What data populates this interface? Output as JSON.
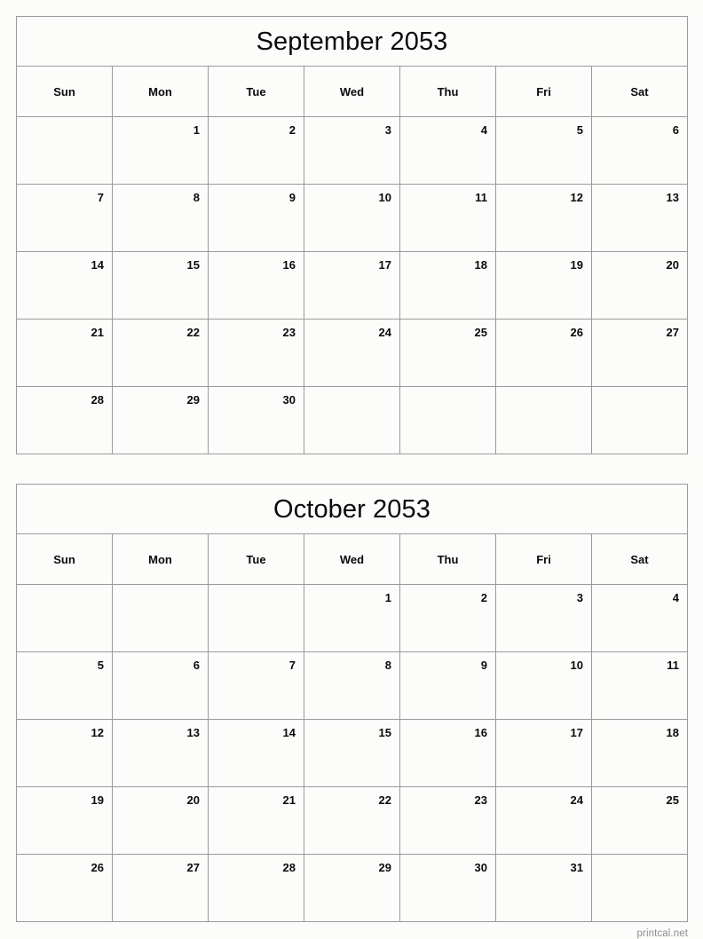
{
  "page": {
    "background_color": "#fcfdfa",
    "border_color": "#9a9a9a",
    "text_color": "#0a0a0a"
  },
  "footer": {
    "credit": "printcal.net",
    "color": "#8d8d8d"
  },
  "weekdays": [
    "Sun",
    "Mon",
    "Tue",
    "Wed",
    "Thu",
    "Fri",
    "Sat"
  ],
  "months": [
    {
      "title": "September 2053",
      "name": "September",
      "year": "2053",
      "weekdays": [
        "Sun",
        "Mon",
        "Tue",
        "Wed",
        "Thu",
        "Fri",
        "Sat"
      ],
      "weeks": [
        [
          "",
          "1",
          "2",
          "3",
          "4",
          "5",
          "6"
        ],
        [
          "7",
          "8",
          "9",
          "10",
          "11",
          "12",
          "13"
        ],
        [
          "14",
          "15",
          "16",
          "17",
          "18",
          "19",
          "20"
        ],
        [
          "21",
          "22",
          "23",
          "24",
          "25",
          "26",
          "27"
        ],
        [
          "28",
          "29",
          "30",
          "",
          "",
          "",
          ""
        ]
      ]
    },
    {
      "title": "October 2053",
      "name": "October",
      "year": "2053",
      "weekdays": [
        "Sun",
        "Mon",
        "Tue",
        "Wed",
        "Thu",
        "Fri",
        "Sat"
      ],
      "weeks": [
        [
          "",
          "",
          "",
          "1",
          "2",
          "3",
          "4"
        ],
        [
          "5",
          "6",
          "7",
          "8",
          "9",
          "10",
          "11"
        ],
        [
          "12",
          "13",
          "14",
          "15",
          "16",
          "17",
          "18"
        ],
        [
          "19",
          "20",
          "21",
          "22",
          "23",
          "24",
          "25"
        ],
        [
          "26",
          "27",
          "28",
          "29",
          "30",
          "31",
          ""
        ]
      ]
    }
  ]
}
